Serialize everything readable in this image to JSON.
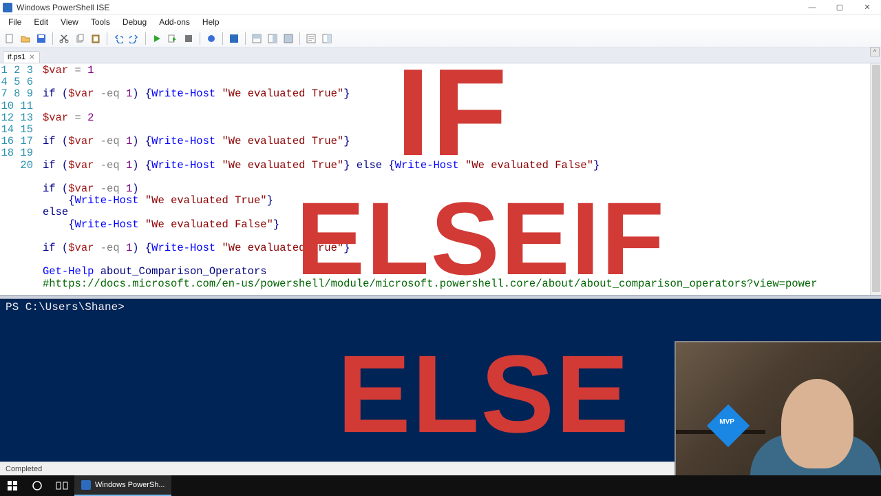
{
  "window": {
    "title": "Windows PowerShell ISE"
  },
  "menu": [
    "File",
    "Edit",
    "View",
    "Tools",
    "Debug",
    "Add-ons",
    "Help"
  ],
  "tab": {
    "name": "if.ps1"
  },
  "code": {
    "lines": 20,
    "l1": {
      "var": "$var",
      "op": " = ",
      "num": "1"
    },
    "l3": {
      "pre": "if (",
      "var": "$var",
      "op": " -eq ",
      "num": "1",
      "mid": ") {",
      "cmd": "Write-Host",
      "sp": " ",
      "str": "\"We evaluated True\"",
      "end": "}"
    },
    "l5": {
      "var": "$var",
      "op": " = ",
      "num": "2"
    },
    "l7": {
      "pre": "if (",
      "var": "$var",
      "op": " -eq ",
      "num": "1",
      "mid": ") {",
      "cmd": "Write-Host",
      "sp": " ",
      "str": "\"We evaluated True\"",
      "end": "}"
    },
    "l9": {
      "pre": "if (",
      "var": "$var",
      "op": " -eq ",
      "num": "1",
      "mid": ") {",
      "cmd": "Write-Host",
      "sp": " ",
      "str": "\"We evaluated True\"",
      "mid2": "} ",
      "kw": "else",
      "mid3": " {",
      "cmd2": "Write-Host",
      "sp2": " ",
      "str2": "\"We evaluated False\"",
      "end": "}"
    },
    "l11": {
      "pre": "if (",
      "var": "$var",
      "op": " -eq ",
      "num": "1",
      "end": ")"
    },
    "l12": {
      "ind": "    {",
      "cmd": "Write-Host",
      "sp": " ",
      "str": "\"We evaluated True\"",
      "end": "}"
    },
    "l13": {
      "kw": "else"
    },
    "l14": {
      "ind": "    {",
      "cmd": "Write-Host",
      "sp": " ",
      "str": "\"We evaluated False\"",
      "end": "}"
    },
    "l16": {
      "pre": "if (",
      "var": "$var",
      "op": " -eq ",
      "num": "1",
      "mid": ") {",
      "cmd": "Write-Host",
      "sp": " ",
      "str": "\"We evaluated True\"",
      "end": "}"
    },
    "l18": {
      "cmd": "Get-Help",
      "sp": " ",
      "par": "about_Comparison_Operators"
    },
    "l19": {
      "cmt": "#https://docs.microsoft.com/en-us/powershell/module/microsoft.powershell.core/about/about_comparison_operators?view=power"
    }
  },
  "console": {
    "prompt": "PS C:\\Users\\Shane>"
  },
  "status": "Completed",
  "overlay": {
    "t1": "IF",
    "t2": "ELSEIF",
    "t3": "ELSE"
  },
  "taskbar": {
    "app": "Windows PowerSh..."
  },
  "webcam": {
    "badge": "MVP"
  }
}
